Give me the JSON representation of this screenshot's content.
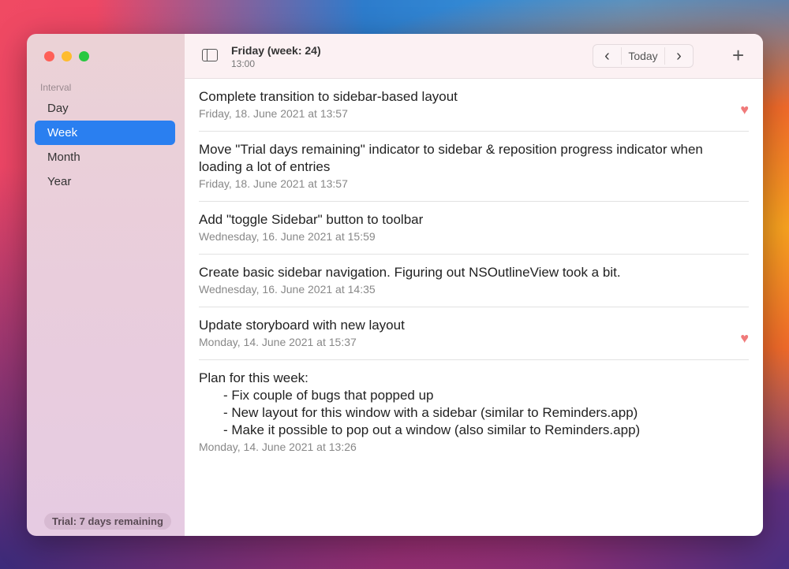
{
  "window": {
    "traffic_lights": {
      "close": "#fe5f57",
      "minimize": "#febc2e",
      "zoom": "#28c840"
    }
  },
  "sidebar": {
    "section_label": "Interval",
    "items": [
      {
        "label": "Day"
      },
      {
        "label": "Week",
        "active": true
      },
      {
        "label": "Month"
      },
      {
        "label": "Year"
      }
    ],
    "trial_badge": "Trial: 7 days remaining"
  },
  "toolbar": {
    "title": "Friday (week: 24)",
    "subtitle": "13:00",
    "prev_icon": "chevron-left",
    "today_label": "Today",
    "next_icon": "chevron-right",
    "add_icon": "plus"
  },
  "entries": [
    {
      "title": "Complete transition to sidebar-based layout",
      "date": "Friday, 18. June 2021 at 13:57",
      "favorite": true
    },
    {
      "title": "Move \"Trial days remaining\" indicator to sidebar & reposition progress indicator when loading a lot of entries",
      "date": "Friday, 18. June 2021 at 13:57",
      "favorite": false
    },
    {
      "title": "Add \"toggle Sidebar\" button to toolbar",
      "date": "Wednesday, 16. June 2021 at 15:59",
      "favorite": false
    },
    {
      "title": "Create basic sidebar navigation. Figuring out NSOutlineView took a bit.",
      "date": "Wednesday, 16. June 2021 at 14:35",
      "favorite": false
    },
    {
      "title": "Update storyboard with new layout",
      "date": "Monday, 14. June 2021 at 15:37",
      "favorite": true
    },
    {
      "title": "Plan for this week:",
      "lines": [
        "- Fix couple of bugs that popped up",
        "- New layout for this window with a sidebar (similar to Reminders.app)",
        "- Make it possible to pop out a window (also similar to Reminders.app)"
      ],
      "date": "Monday, 14. June 2021 at 13:26",
      "favorite": false
    }
  ]
}
